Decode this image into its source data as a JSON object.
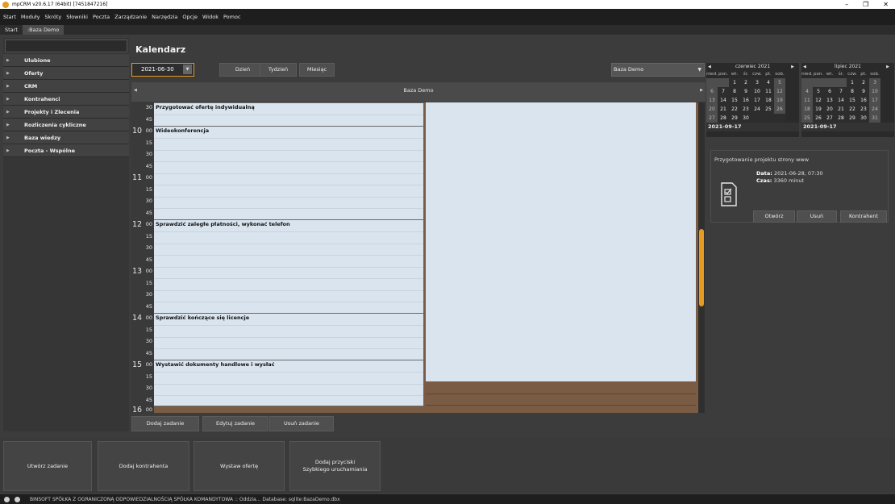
{
  "window": {
    "title": "mpCRM v20.6.17 (64bit) [7451847216]",
    "minimize": "–",
    "maximize": "❐",
    "close": "✕"
  },
  "menu": [
    "Start",
    "Moduły",
    "Skróty",
    "Słowniki",
    "Poczta",
    "Zarządzanie",
    "Narzędzia",
    "Opcje",
    "Widok",
    "Pomoc"
  ],
  "tabs": [
    {
      "label": "Start"
    },
    {
      "label": ":Baza Demo"
    }
  ],
  "nav": {
    "search_value": "",
    "items": [
      "Ulubione",
      "Oferty",
      "CRM",
      "Kontrahenci",
      "Projekty i Zlecenia",
      "Rozliczenia cykliczne",
      "Baza wiedzy",
      "Poczta - Wspólne"
    ]
  },
  "main": {
    "title": "Kalendarz"
  },
  "toolbar": {
    "date_value": "2021-06-30",
    "day": "Dzień",
    "week": "Tydzień",
    "month": "Miesiąc",
    "calendar_select": "Baza Demo"
  },
  "calendar": {
    "header_title": "Baza Demo",
    "hours": [
      "10",
      "11",
      "12",
      "13",
      "14",
      "15",
      "16"
    ],
    "minute_labels": [
      "00",
      "15",
      "30",
      "45"
    ],
    "events": [
      "Przygotować ofertę indywidualną",
      "Wideokonferencja",
      "Sprawdzić zaległe płatności, wykonać telefon",
      "Sprawdzić kończące się licencje",
      "Wystawić dokumenty handlowe i wysłać"
    ],
    "add_task": "Dodaj zadanie",
    "edit_task": "Edytuj zadanie",
    "delete_task": "Usuń zadanie"
  },
  "minicals": [
    {
      "month_label": "czerwiec 2021",
      "dow": [
        "nied.",
        "pon.",
        "wt.",
        "śr.",
        "czw.",
        "pt.",
        "sob."
      ],
      "weeks": [
        [
          "",
          "",
          "1",
          "2",
          "3",
          "4",
          "5"
        ],
        [
          "6",
          "7",
          "8",
          "9",
          "10",
          "11",
          "12"
        ],
        [
          "13",
          "14",
          "15",
          "16",
          "17",
          "18",
          "19"
        ],
        [
          "20",
          "21",
          "22",
          "23",
          "24",
          "25",
          "26"
        ],
        [
          "27",
          "28",
          "29",
          "30",
          "",
          "",
          ""
        ]
      ],
      "today": "2021-09-17"
    },
    {
      "month_label": "lipiec 2021",
      "dow": [
        "nied.",
        "pon.",
        "wt.",
        "śr.",
        "czw.",
        "pt.",
        "sob."
      ],
      "weeks": [
        [
          "",
          "",
          "",
          "",
          "1",
          "2",
          "3"
        ],
        [
          "4",
          "5",
          "6",
          "7",
          "8",
          "9",
          "10"
        ],
        [
          "11",
          "12",
          "13",
          "14",
          "15",
          "16",
          "17"
        ],
        [
          "18",
          "19",
          "20",
          "21",
          "22",
          "23",
          "24"
        ],
        [
          "25",
          "26",
          "27",
          "28",
          "29",
          "30",
          "31"
        ]
      ],
      "today": "2021-09-17"
    }
  ],
  "detail": {
    "title": "Przygotowanie projektu strony www",
    "date_label": "Data:",
    "date_value": "2021-06-28, 07:30",
    "time_label": "Czas:",
    "time_value": "3360 minut",
    "open": "Otwórz",
    "delete": "Usuń",
    "contractor": "Kontrahent"
  },
  "quick": {
    "create_task": "Utwórz zadanie",
    "add_contractor": "Dodaj kontrahenta",
    "issue_offer": "Wystaw ofertę",
    "add_buttons_line1": "Dodaj przyciski",
    "add_buttons_line2": "Szybkiego uruchamiania"
  },
  "status": {
    "text": "BINSOFT SPÓŁKA Z OGRANICZONĄ ODPOWIEDZIALNOŚCIĄ SPÓŁKA KOMANDYTOWA :: Oddzia... Database: sqlite:BazaDemo.dbx"
  }
}
